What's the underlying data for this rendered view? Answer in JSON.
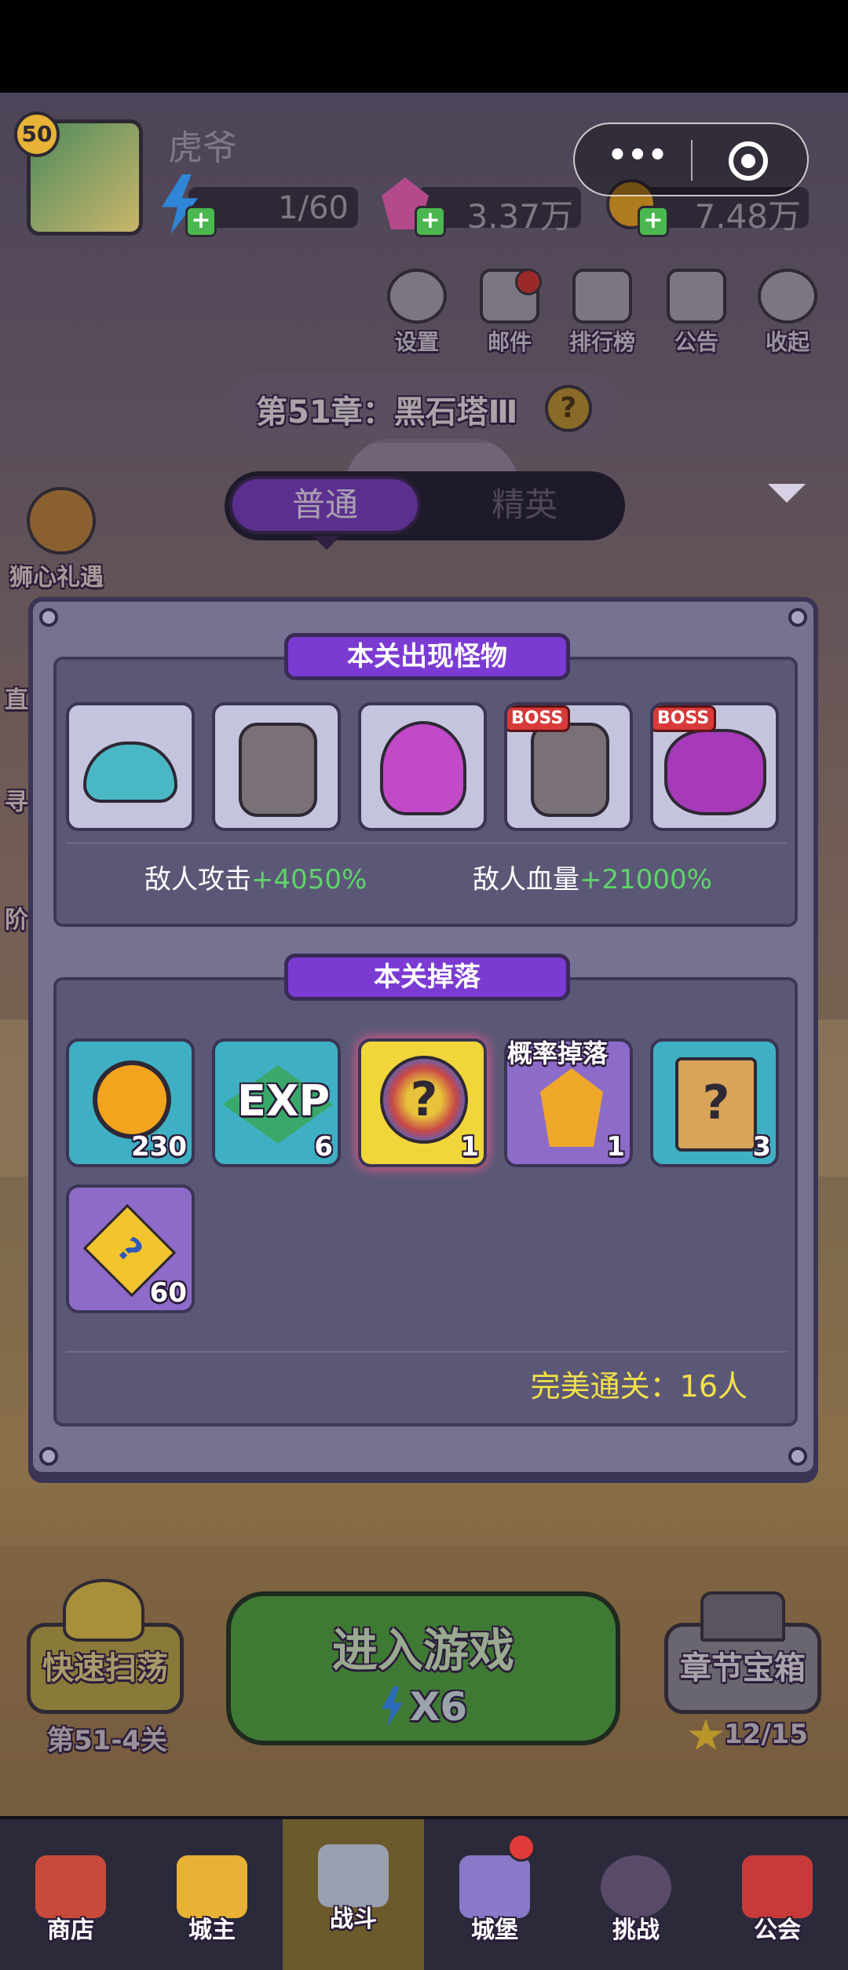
{
  "player": {
    "level": "50",
    "name": "虎爷",
    "energy": "1/60",
    "gems": "3.37万",
    "coins": "7.48万"
  },
  "capsule": {
    "more_icon": "more-dots-icon",
    "close_icon": "target-close-icon"
  },
  "top_menu": [
    {
      "label": "设置",
      "icon": "gear-icon"
    },
    {
      "label": "邮件",
      "icon": "mail-icon"
    },
    {
      "label": "排行榜",
      "icon": "ranking-icon"
    },
    {
      "label": "公告",
      "icon": "megaphone-icon"
    },
    {
      "label": "收起",
      "icon": "collapse-icon"
    }
  ],
  "chapter": {
    "title": "第51章：黑石塔Ⅲ",
    "help": "?"
  },
  "mode_tabs": [
    {
      "label": "普通",
      "active": true
    },
    {
      "label": "精英",
      "active": false
    }
  ],
  "side_event": {
    "label": "狮心礼遇"
  },
  "side_partial": [
    "直",
    "寻",
    "阶"
  ],
  "panel": {
    "monsters_title": "本关出现怪物",
    "monsters": [
      {
        "name": "blue-slime",
        "boss": false
      },
      {
        "name": "horned-knight",
        "boss": false
      },
      {
        "name": "purple-spider",
        "boss": false
      },
      {
        "name": "horned-knight",
        "boss": true
      },
      {
        "name": "purple-spider",
        "boss": true
      }
    ],
    "boss_badge": "BOSS",
    "enemy_attack_label": "敌人攻击",
    "enemy_attack_value": "+4050%",
    "enemy_hp_label": "敌人血量",
    "enemy_hp_value": "+21000%",
    "drops_title": "本关掉落",
    "drops": [
      {
        "item": "coin",
        "count": "230"
      },
      {
        "item": "exp",
        "count": "6",
        "label": "EXP"
      },
      {
        "item": "gem-bag",
        "count": "1"
      },
      {
        "item": "fire-crystal",
        "count": "1",
        "tag": "概率掉落"
      },
      {
        "item": "mystery-scroll",
        "count": "3"
      },
      {
        "item": "puzzle-piece",
        "count": "60"
      }
    ],
    "perfect_clear": "完美通关：16人"
  },
  "actions": {
    "sweep_label": "快速扫荡",
    "sweep_stage": "第51-4关",
    "enter_label": "进入游戏",
    "enter_cost": "X6",
    "chest_label": "章节宝箱",
    "chest_stars": "12/15"
  },
  "bottom_nav": [
    {
      "label": "商店",
      "icon": "shop-icon",
      "active": false
    },
    {
      "label": "城主",
      "icon": "crown-icon",
      "active": false
    },
    {
      "label": "战斗",
      "icon": "swords-icon",
      "active": true
    },
    {
      "label": "城堡",
      "icon": "castle-icon",
      "active": false
    },
    {
      "label": "挑战",
      "icon": "demon-icon",
      "active": false
    },
    {
      "label": "公会",
      "icon": "banner-icon",
      "active": false
    }
  ],
  "colors": {
    "accent_purple": "#7b3bd3",
    "bonus_green": "#5fd36a",
    "gold_text": "#f3e04a",
    "panel": "#767291"
  }
}
